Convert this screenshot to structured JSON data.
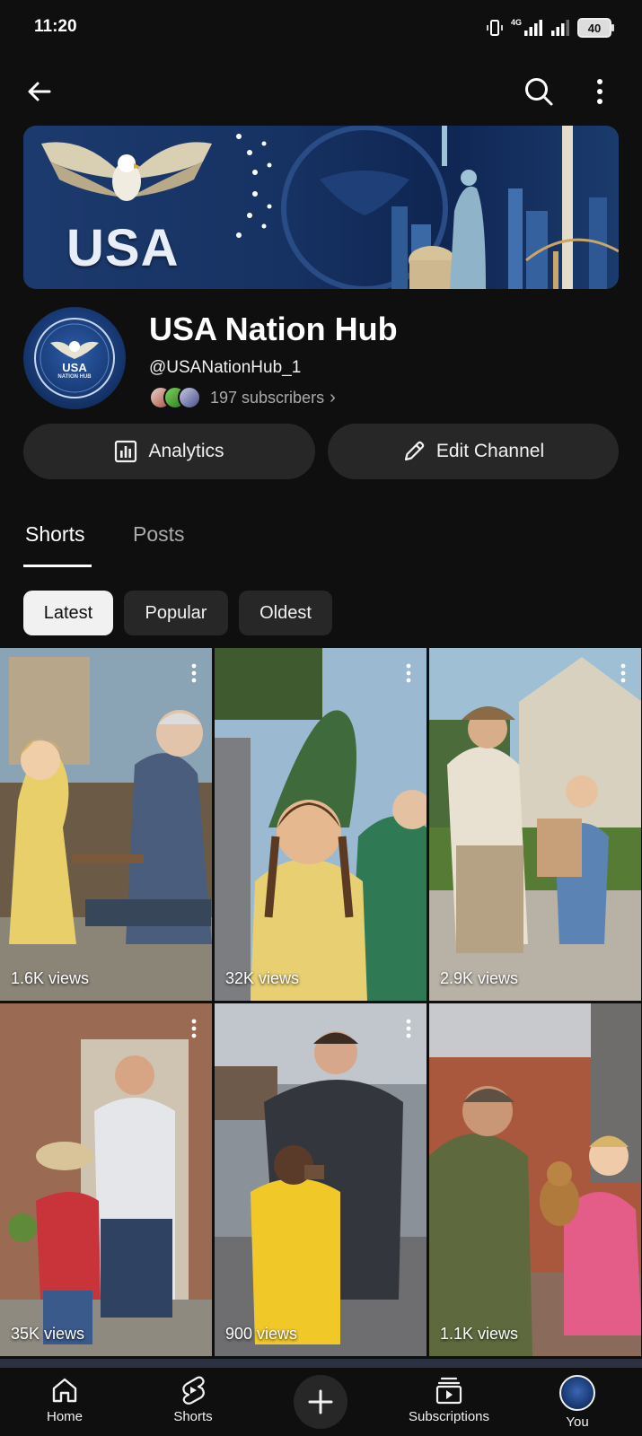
{
  "status_bar": {
    "time": "11:20",
    "network": "4G",
    "battery": "40"
  },
  "topbar": {
    "back_icon": "arrow-left-icon",
    "search_icon": "search-icon",
    "more_icon": "more-vert-icon"
  },
  "banner": {
    "title": "USA"
  },
  "avatar": {
    "text_line": "USA",
    "sub_line": "NATION HUB"
  },
  "channel": {
    "name": "USA Nation Hub",
    "handle": "@USANationHub_1",
    "subscribers": "197 subscribers",
    "subscribers_chevron": "›"
  },
  "actions": {
    "analytics_label": "Analytics",
    "edit_label": "Edit Channel"
  },
  "tabs": [
    {
      "label": "Shorts",
      "active": true
    },
    {
      "label": "Posts",
      "active": false
    }
  ],
  "filters": [
    {
      "label": "Latest",
      "active": true
    },
    {
      "label": "Popular",
      "active": false
    },
    {
      "label": "Oldest",
      "active": false
    }
  ],
  "shorts": [
    {
      "views": "1.6K views"
    },
    {
      "views": "32K views"
    },
    {
      "views": "2.9K views"
    },
    {
      "views": "35K views"
    },
    {
      "views": "900 views"
    },
    {
      "views": "1.1K views"
    }
  ],
  "bottom_nav": [
    {
      "label": "Home",
      "icon": "home-icon"
    },
    {
      "label": "Shorts",
      "icon": "shorts-icon"
    },
    {
      "label": "",
      "icon": "create-plus-icon"
    },
    {
      "label": "Subscriptions",
      "icon": "subscriptions-icon"
    },
    {
      "label": "You",
      "icon": "you-avatar-icon"
    }
  ],
  "colors": {
    "background": "#0f0f0f",
    "surface": "#272727",
    "text": "#f1f1f1",
    "muted": "#aaaaaa"
  }
}
